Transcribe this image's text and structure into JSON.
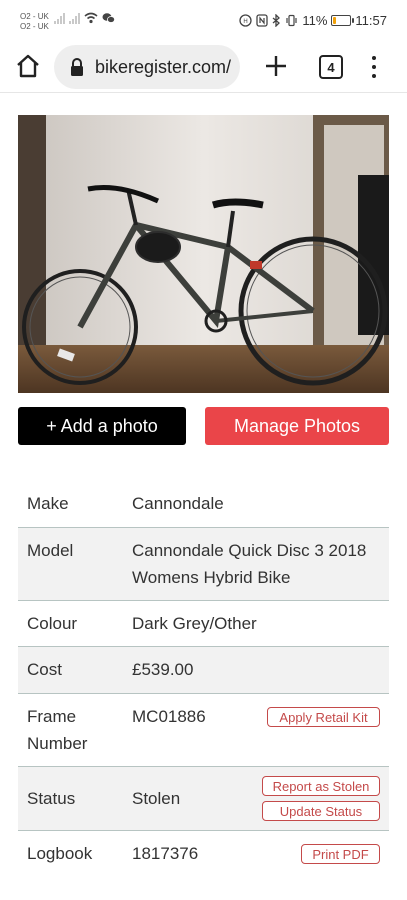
{
  "status_bar": {
    "carrier_1": "O2 - UK",
    "carrier_2": "O2 - UK",
    "battery_percent": "11%",
    "battery_level": 0.11,
    "time": "11:57",
    "icons": [
      "signal-icon",
      "wifi-icon",
      "wechat-icon",
      "hd-icon",
      "nfc-icon",
      "bluetooth-icon",
      "vibrate-icon",
      "battery-icon"
    ]
  },
  "browser": {
    "url": "bikeregister.com/",
    "tab_count": "4",
    "icons": [
      "home-icon",
      "lock-icon",
      "plus-icon",
      "tabs-icon",
      "menu-icon"
    ]
  },
  "actions": {
    "add_photo": "+ Add a photo",
    "manage_photos": "Manage Photos"
  },
  "details": {
    "make_label": "Make",
    "make_value": "Cannondale",
    "model_label": "Model",
    "model_value_line1": "Cannondale Quick Disc 3 2018",
    "model_value_line2": "Womens Hybrid Bike",
    "colour_label": "Colour",
    "colour_value": "Dark Grey/Other",
    "cost_label": "Cost",
    "cost_value": "£539.00",
    "frame_label_line1": "Frame",
    "frame_label_line2": "Number",
    "frame_value": "MC01886",
    "apply_retail_kit": "Apply Retail Kit",
    "status_label": "Status",
    "status_value": "Stolen",
    "report_stolen": "Report as Stolen",
    "update_status": "Update Status",
    "logbook_label": "Logbook",
    "logbook_value": "1817376",
    "print_pdf": "Print PDF"
  },
  "colors": {
    "accent_red": "#ea4549",
    "outline_red": "#c44a4a",
    "row_alt": "#f2f2f2",
    "divider": "#b7c4c2"
  }
}
